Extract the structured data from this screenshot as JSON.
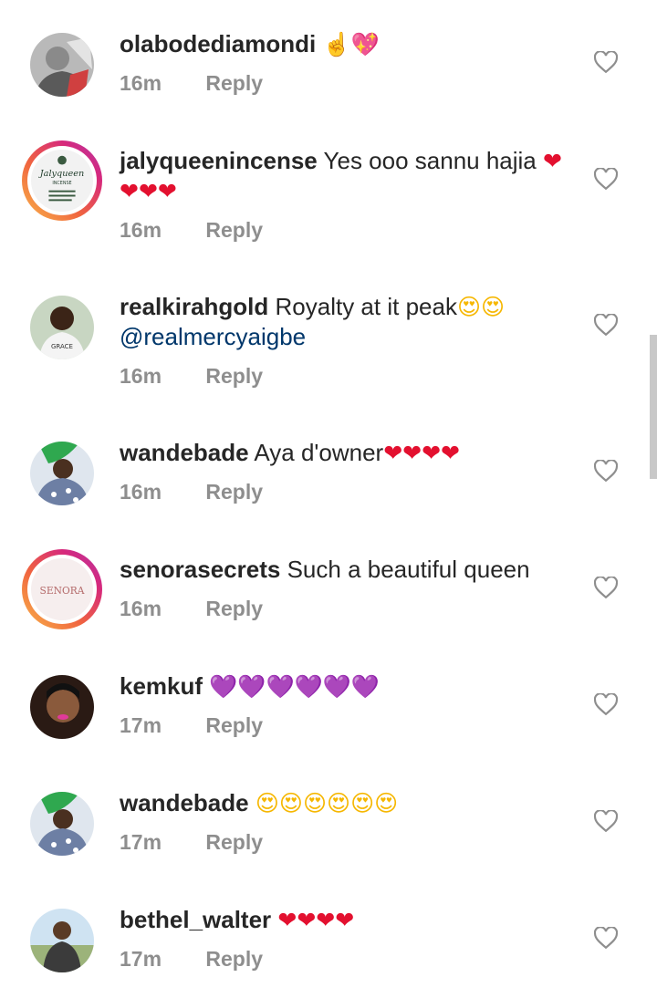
{
  "colors": {
    "username": "#262626",
    "meta": "#8e8e8e",
    "mention": "#00376b",
    "red_heart": "#e3102f",
    "purple_heart": "#8e24c9"
  },
  "comments": [
    {
      "username": "olabodediamondi",
      "text": "",
      "emoji": "☝️💖",
      "time": "16m",
      "reply": "Reply",
      "avatar_icon": "profile-photo-icon",
      "story_ring": false
    },
    {
      "username": "jalyqueenincense",
      "text": "Yes ooo sannu hajia",
      "emoji": "❤❤❤❤",
      "time": "16m",
      "reply": "Reply",
      "avatar_icon": "jalyqueen-logo-icon",
      "avatar_logo_text": "Jalyqueen",
      "avatar_logo_sub": "INCENSE",
      "story_ring": true
    },
    {
      "username": "realkirahgold",
      "text": "Royalty at it peak",
      "emoji": "😍😍",
      "mention": "@realmercyaigbe",
      "time": "16m",
      "reply": "Reply",
      "avatar_icon": "profile-photo-icon",
      "story_ring": false
    },
    {
      "username": "wandebade",
      "text": "Aya d'owner",
      "emoji": "❤❤❤❤",
      "time": "16m",
      "reply": "Reply",
      "avatar_icon": "profile-photo-icon",
      "story_ring": false
    },
    {
      "username": "senorasecrets",
      "text": "Such a beautiful queen",
      "emoji": "",
      "time": "16m",
      "reply": "Reply",
      "avatar_icon": "senora-logo-icon",
      "avatar_logo_text": "SENORA",
      "story_ring": true
    },
    {
      "username": "kemkuf",
      "text": "",
      "emoji": "💜💜💜💜💜💜",
      "time": "17m",
      "reply": "Reply",
      "avatar_icon": "profile-photo-icon",
      "story_ring": false
    },
    {
      "username": "wandebade",
      "text": "",
      "emoji": "😍😍😍😍😍😍",
      "time": "17m",
      "reply": "Reply",
      "avatar_icon": "profile-photo-icon",
      "story_ring": false
    },
    {
      "username": "bethel_walter",
      "text": "",
      "emoji": "❤❤❤❤",
      "time": "17m",
      "reply": "Reply",
      "avatar_icon": "profile-photo-icon",
      "story_ring": false
    }
  ]
}
